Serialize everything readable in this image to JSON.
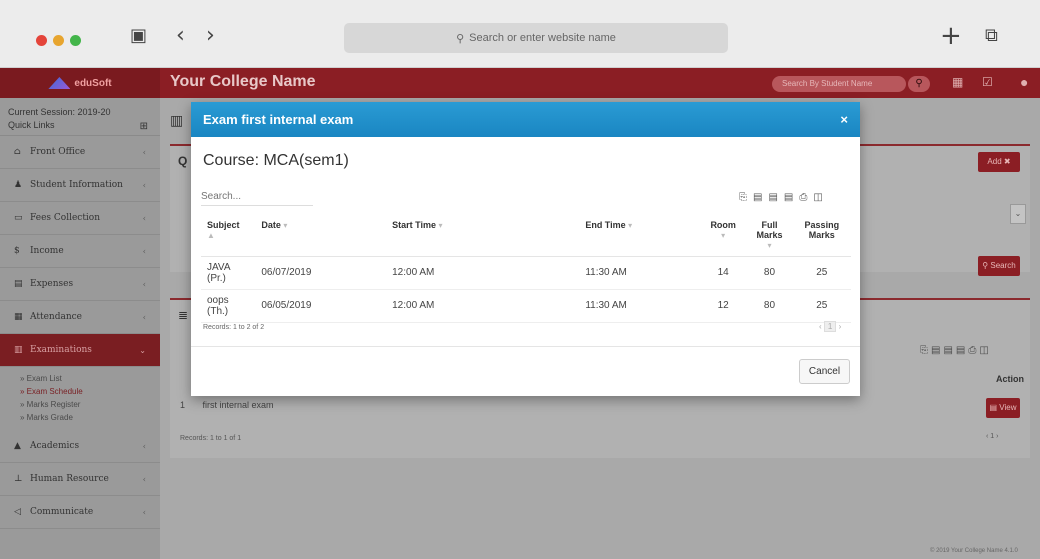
{
  "browser": {
    "address_placeholder": "Search or enter website name"
  },
  "header": {
    "logo_text": "eduSoft",
    "college_name": "Your College Name",
    "search_placeholder": "Search By Student Name"
  },
  "sidebar": {
    "session": "Current Session: 2019-20",
    "quick_links": "Quick Links",
    "items": [
      {
        "label": "Front Office",
        "icon": "building-icon"
      },
      {
        "label": "Student Information",
        "icon": "users-icon"
      },
      {
        "label": "Fees Collection",
        "icon": "money-icon"
      },
      {
        "label": "Income",
        "icon": "dollar-icon"
      },
      {
        "label": "Expenses",
        "icon": "card-icon"
      },
      {
        "label": "Attendance",
        "icon": "calendar-icon"
      },
      {
        "label": "Examinations",
        "icon": "map-icon"
      },
      {
        "label": "Academics",
        "icon": "graduation-icon"
      },
      {
        "label": "Human Resource",
        "icon": "sitemap-icon"
      },
      {
        "label": "Communicate",
        "icon": "bullhorn-icon"
      }
    ],
    "sub_items": [
      "Exam List",
      "Exam Schedule",
      "Marks Register",
      "Marks Grade"
    ]
  },
  "main": {
    "add_label": "Add",
    "search_label": "Search",
    "action_label": "Action",
    "row_label": "first internal exam",
    "row_num": "1",
    "view_label": "View",
    "records": "Records: 1 to 1 of 1",
    "footer": "© 2019 Your College Name 4.1.0"
  },
  "modal": {
    "title": "Exam first internal exam",
    "course": "Course: MCA(sem1)",
    "search_placeholder": "Search...",
    "columns": {
      "subject": "Subject",
      "date": "Date",
      "start": "Start Time",
      "end": "End Time",
      "room": "Room",
      "full": "Full Marks",
      "passing": "Passing Marks"
    },
    "rows": [
      {
        "subject": "JAVA (Pr.)",
        "date": "06/07/2019",
        "start": "12:00 AM",
        "end": "11:30 AM",
        "room": "14",
        "full": "80",
        "passing": "25"
      },
      {
        "subject": "oops (Th.)",
        "date": "06/05/2019",
        "start": "12:00 AM",
        "end": "11:30 AM",
        "room": "12",
        "full": "80",
        "passing": "25"
      }
    ],
    "records": "Records: 1 to 2 of 2",
    "page": "1",
    "cancel_label": "Cancel"
  }
}
